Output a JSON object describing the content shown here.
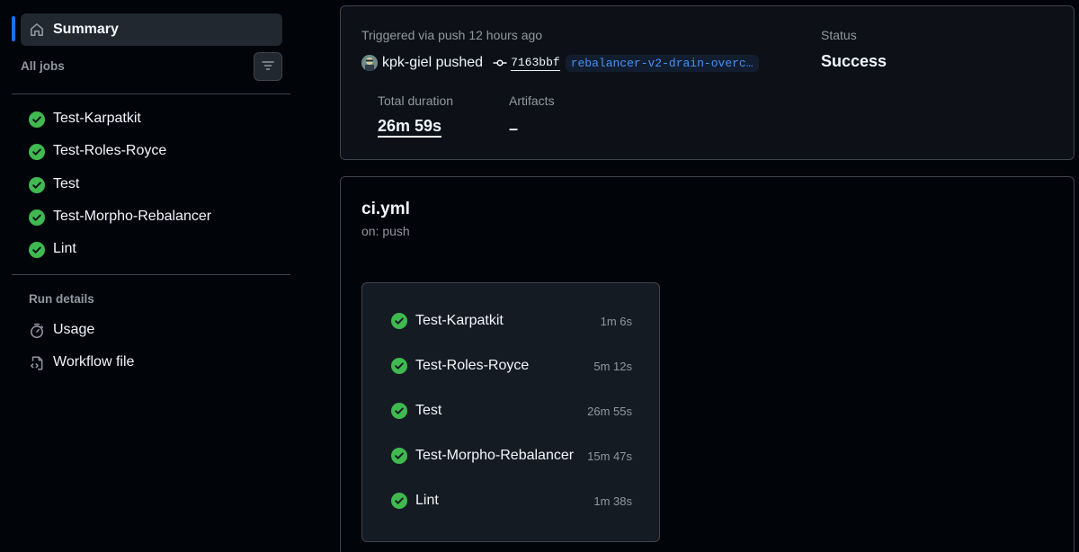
{
  "sidebar": {
    "summary_label": "Summary",
    "all_jobs_label": "All jobs",
    "jobs": [
      {
        "label": "Test-Karpatkit"
      },
      {
        "label": "Test-Roles-Royce"
      },
      {
        "label": "Test"
      },
      {
        "label": "Test-Morpho-Rebalancer"
      },
      {
        "label": "Lint"
      }
    ],
    "run_details_label": "Run details",
    "usage_label": "Usage",
    "workflow_file_label": "Workflow file"
  },
  "run": {
    "trigger_text": "Triggered via push 12 hours ago",
    "actor": "kpk-giel pushed",
    "commit_sha": "7163bbf",
    "branch": "rebalancer-v2-drain-overc…",
    "status_label": "Status",
    "status_value": "Success",
    "duration_label": "Total duration",
    "duration_value": "26m 59s",
    "artifacts_label": "Artifacts",
    "artifacts_value": "–"
  },
  "workflow": {
    "title": "ci.yml",
    "subtitle": "on: push",
    "jobs": [
      {
        "label": "Test-Karpatkit",
        "duration": "1m 6s"
      },
      {
        "label": "Test-Roles-Royce",
        "duration": "5m 12s"
      },
      {
        "label": "Test",
        "duration": "26m 55s"
      },
      {
        "label": "Test-Morpho-Rebalancer",
        "duration": "15m 47s"
      },
      {
        "label": "Lint",
        "duration": "1m 38s"
      }
    ]
  },
  "colors": {
    "success": "#3fb950",
    "accent": "#1f6feb",
    "link": "#4493f8",
    "background": "#010409",
    "card": "#0d1117"
  },
  "icons": [
    "home-icon",
    "filter-icon",
    "check-circle-icon",
    "stopwatch-icon",
    "file-code-icon",
    "git-commit-icon",
    "avatar"
  ]
}
